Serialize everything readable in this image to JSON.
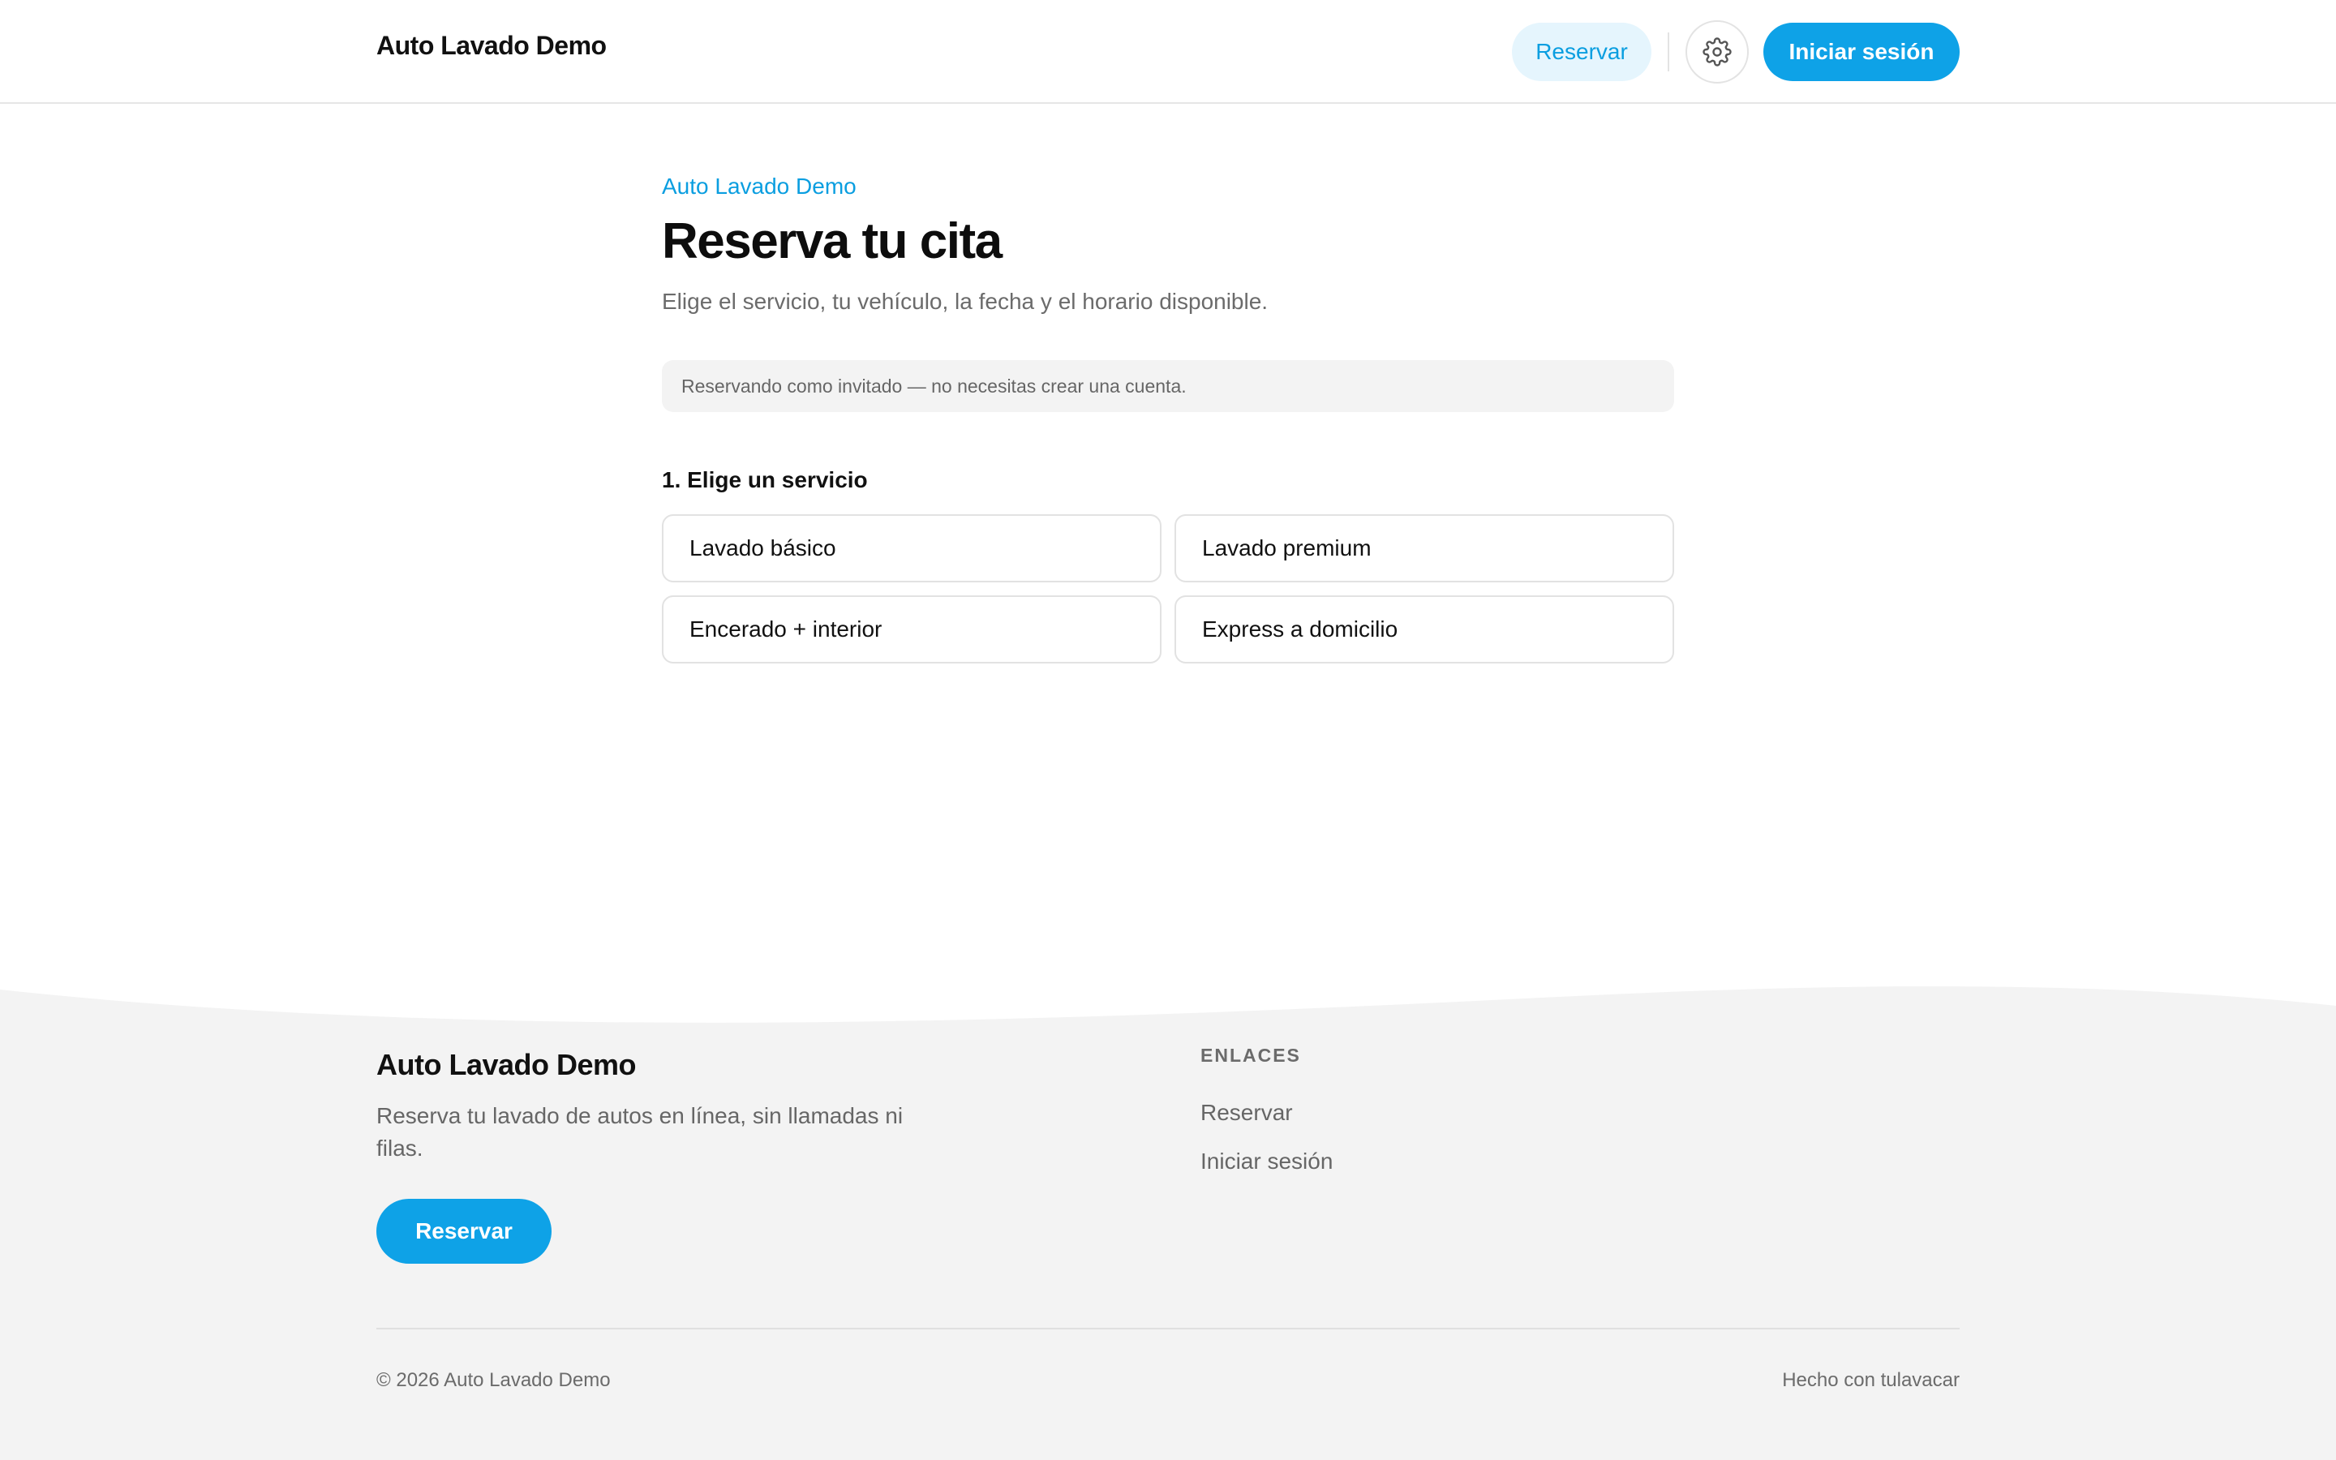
{
  "header": {
    "brand": "Auto Lavado Demo",
    "reserve_label": "Reservar",
    "settings_icon": "gear-icon",
    "login_label": "Iniciar sesión"
  },
  "main": {
    "eyebrow": "Auto Lavado Demo",
    "title": "Reserva tu cita",
    "subtitle": "Elige el servicio, tu vehículo, la fecha y el horario disponible.",
    "notice": "Reservando como invitado — no necesitas crear una cuenta.",
    "section_title": "1. Elige un servicio",
    "services": [
      "Lavado básico",
      "Lavado premium",
      "Encerado + interior",
      "Express a domicilio"
    ]
  },
  "footer": {
    "brand": "Auto Lavado Demo",
    "description": "Reserva tu lavado de autos en línea, sin llamadas ni filas.",
    "cta_label": "Reservar",
    "links_heading": "ENLACES",
    "links": [
      "Reservar",
      "Iniciar sesión"
    ],
    "copyright": "© 2026 Auto Lavado Demo",
    "made_with": "Hecho con tulavacar"
  },
  "colors": {
    "accent": "#0ea2e7",
    "accent_soft": "#e5f5fd",
    "footer_bg": "#f3f3f3"
  }
}
